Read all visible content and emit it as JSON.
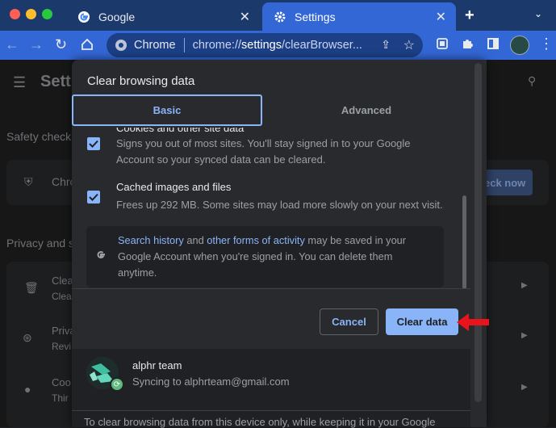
{
  "browser": {
    "tabs": [
      {
        "title": "Google",
        "active": false
      },
      {
        "title": "Settings",
        "active": true
      }
    ],
    "omnibox": {
      "site_label": "Chrome",
      "url_prefix": "chrome://",
      "url_bold": "settings",
      "url_rest": "/clearBrowser..."
    }
  },
  "background": {
    "header": "Setti",
    "safety_check": "Safety check",
    "safety_row": "Chro",
    "check_now": "eck now",
    "privacy": "Privacy and s",
    "rows": [
      {
        "title": "Clea",
        "sub": "Clea"
      },
      {
        "title": "Priva",
        "sub": "Revi"
      },
      {
        "title": "Coo",
        "sub": "Thir"
      }
    ]
  },
  "dialog": {
    "title": "Clear browsing data",
    "tabs": {
      "basic": "Basic",
      "advanced": "Advanced"
    },
    "items": [
      {
        "title": "Cookies and other site data",
        "desc_lines": [
          "Signs you out of most sites. You'll stay signed in to your Google",
          "Account so your synced data can be cleared."
        ],
        "checked": true
      },
      {
        "title": "Cached images and files",
        "desc_lines": [
          "Frees up 292 MB. Some sites may load more slowly on your next visit."
        ],
        "checked": true
      }
    ],
    "info": {
      "link1": "Search history",
      "mid1": " and ",
      "link2": "other forms of activity",
      "rest1": " may be saved in your",
      "line2": "Google Account when you're signed in. You can delete them",
      "line3": "anytime."
    },
    "buttons": {
      "cancel": "Cancel",
      "clear": "Clear data"
    },
    "account": {
      "name": "alphr team",
      "sync": "Syncing to alphrteam@gmail.com"
    },
    "footer": "To clear browsing data from this device only, while keeping it in your Google"
  },
  "colors": {
    "accent": "#8ab4f8",
    "tab_active": "#3367d6",
    "arrow": "#e8131b"
  }
}
